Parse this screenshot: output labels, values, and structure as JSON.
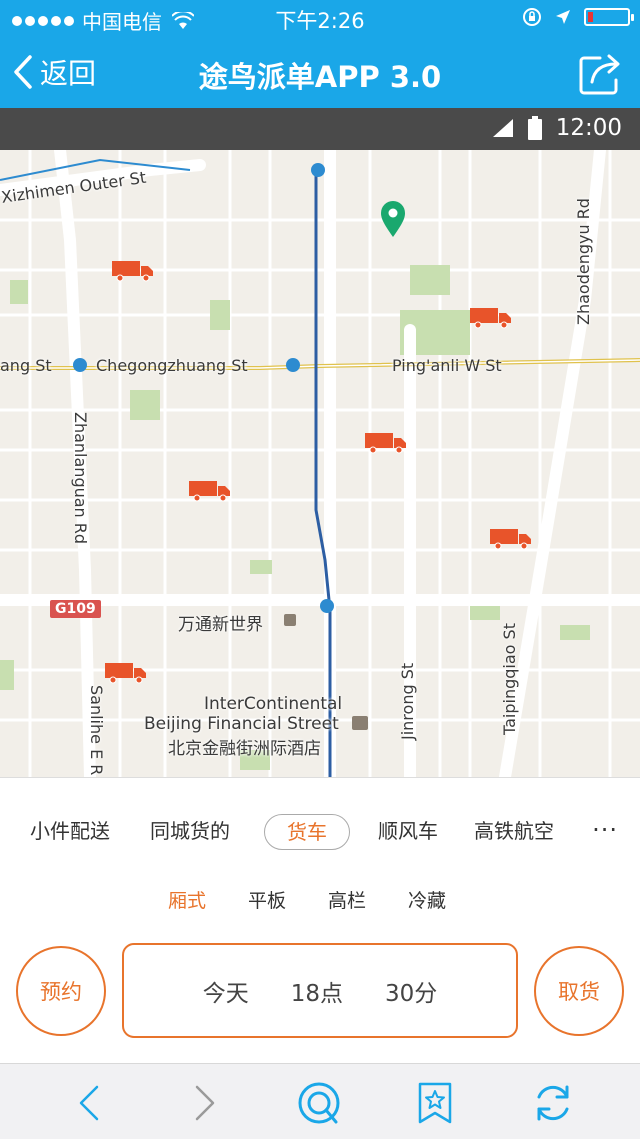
{
  "status_bar": {
    "carrier": "中国电信",
    "time": "下午2:26"
  },
  "nav": {
    "back_label": "返回",
    "title": "途鸟派单APP 3.0"
  },
  "device_bar": {
    "time": "12:00"
  },
  "map": {
    "streets": {
      "xizhimen": "Xizhimen Outer St",
      "chegongzhuang": "Chegongzhuang St",
      "chegong_left": "ang St",
      "pinganli": "Ping'anli W St",
      "zhanlanguan": "Zhanlanguan Rd",
      "zhaodengyu": "Zhaodengyu Rd",
      "jinrong": "Jinrong St",
      "taipingqiao": "Taipingqiao St",
      "sanlihe": "Sanlihe E R"
    },
    "highway_badge": "G109",
    "poi_wantong": "万通新世界",
    "poi_hotel_en_1": "InterContinental",
    "poi_hotel_en_2": "Beijing Financial Street",
    "poi_hotel_cn": "北京金融街洲际酒店",
    "truck_color": "#e8542a",
    "pin_color": "#1aa86e"
  },
  "categories": {
    "items": [
      "小件配送",
      "同城货的",
      "货车",
      "顺风车",
      "高铁航空"
    ],
    "more": "···"
  },
  "subcategories": {
    "items": [
      "厢式",
      "平板",
      "高栏",
      "冷藏"
    ]
  },
  "actions": {
    "reserve": "预约",
    "pickup": "取货"
  },
  "time_picker": {
    "day": "今天",
    "hour": "18点",
    "minute": "30分"
  },
  "colors": {
    "brand_blue": "#1aa7e8",
    "accent_orange": "#e8742c"
  }
}
